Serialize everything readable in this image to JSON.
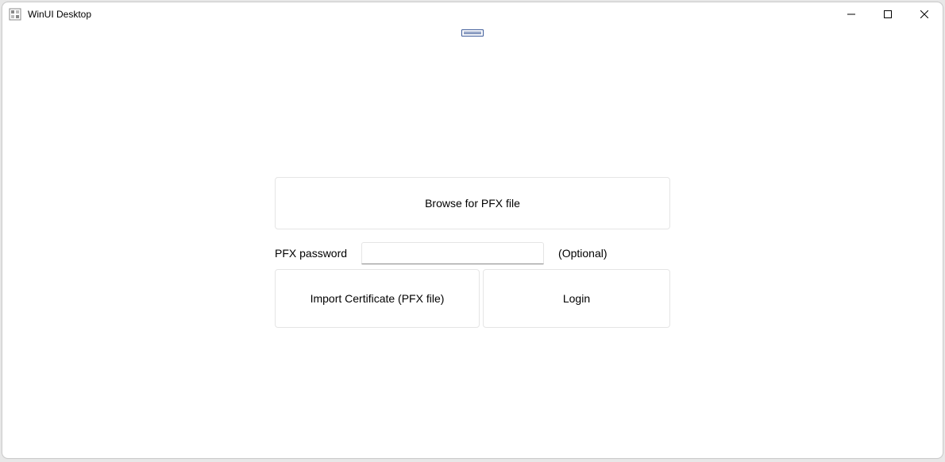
{
  "window": {
    "title": "WinUI Desktop"
  },
  "form": {
    "browse_label": "Browse for PFX file",
    "password_label": "PFX password",
    "password_value": "",
    "optional_label": "(Optional)",
    "import_label": "Import Certificate (PFX file)",
    "login_label": "Login"
  }
}
